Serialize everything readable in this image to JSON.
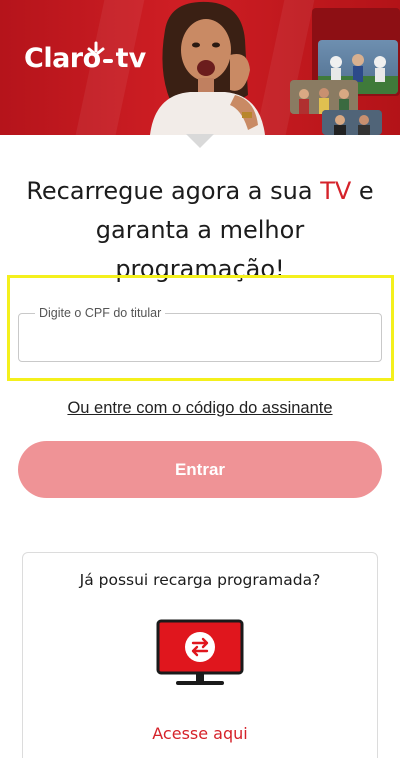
{
  "hero": {
    "brand_main": "Claro",
    "brand_suffix": "tv",
    "colors": {
      "brand_red": "#cf1e24",
      "accent_red": "#d5222a"
    }
  },
  "headline": {
    "line1_start": "Recarregue agora a sua ",
    "line1_accent": "TV",
    "line1_end": " e",
    "line2": "garanta a melhor",
    "line3": "programação!"
  },
  "cpf_field": {
    "label": "Digite o CPF do titular",
    "value": ""
  },
  "alt_login": {
    "link_text": "Ou entre com o código do assinante"
  },
  "enter_button": {
    "label": "Entrar",
    "color": "#ef9396"
  },
  "scheduled_card": {
    "title": "Já possui recarga programada?",
    "icon": "tv-recharge-icon",
    "link_text": "Acesse aqui"
  }
}
